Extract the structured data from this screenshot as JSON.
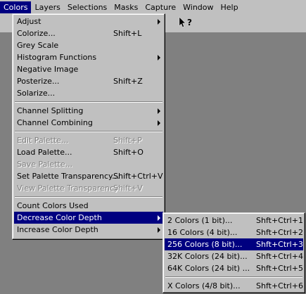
{
  "menubar": [
    "Colors",
    "Layers",
    "Selections",
    "Masks",
    "Capture",
    "Window",
    "Help"
  ],
  "colors_menu": {
    "groups": [
      [
        {
          "label": "Adjust",
          "shortcut": "",
          "submenu": true,
          "disabled": false
        },
        {
          "label": "Colorize...",
          "shortcut": "Shift+L",
          "submenu": false,
          "disabled": false
        },
        {
          "label": "Grey Scale",
          "shortcut": "",
          "submenu": false,
          "disabled": false
        },
        {
          "label": "Histogram Functions",
          "shortcut": "",
          "submenu": true,
          "disabled": false
        },
        {
          "label": "Negative Image",
          "shortcut": "",
          "submenu": false,
          "disabled": false
        },
        {
          "label": "Posterize...",
          "shortcut": "Shift+Z",
          "submenu": false,
          "disabled": false
        },
        {
          "label": "Solarize...",
          "shortcut": "",
          "submenu": false,
          "disabled": false
        }
      ],
      [
        {
          "label": "Channel Splitting",
          "shortcut": "",
          "submenu": true,
          "disabled": false
        },
        {
          "label": "Channel Combining",
          "shortcut": "",
          "submenu": true,
          "disabled": false
        }
      ],
      [
        {
          "label": "Edit Palette...",
          "shortcut": "Shift+P",
          "submenu": false,
          "disabled": true
        },
        {
          "label": "Load Palette...",
          "shortcut": "Shift+O",
          "submenu": false,
          "disabled": false
        },
        {
          "label": "Save Palette...",
          "shortcut": "",
          "submenu": false,
          "disabled": true
        },
        {
          "label": "Set Palette Transparency...",
          "shortcut": "Shift+Ctrl+V",
          "submenu": false,
          "disabled": false
        },
        {
          "label": "View Palette Transparency",
          "shortcut": "Shift+V",
          "submenu": false,
          "disabled": true
        }
      ],
      [
        {
          "label": "Count Colors Used",
          "shortcut": "",
          "submenu": false,
          "disabled": false
        },
        {
          "label": "Decrease Color Depth",
          "shortcut": "",
          "submenu": true,
          "disabled": false,
          "highlighted": true
        },
        {
          "label": "Increase Color Depth",
          "shortcut": "",
          "submenu": true,
          "disabled": false
        }
      ]
    ]
  },
  "depth_submenu": {
    "groups": [
      [
        {
          "label": "2 Colors (1 bit)...",
          "shortcut": "Shft+Ctrl+1"
        },
        {
          "label": "16 Colors (4 bit)...",
          "shortcut": "Shft+Ctrl+2"
        },
        {
          "label": "256 Colors (8 bit)...",
          "shortcut": "Shft+Ctrl+3",
          "highlighted": true
        },
        {
          "label": "32K Colors (24 bit)...",
          "shortcut": "Shft+Ctrl+4"
        },
        {
          "label": "64K Colors (24 bit) ...",
          "shortcut": "Shft+Ctrl+5"
        }
      ],
      [
        {
          "label": "X Colors (4/8 bit)...",
          "shortcut": "Shft+Ctrl+6"
        }
      ]
    ]
  },
  "toolbar": {
    "help_icon_text": "?"
  }
}
